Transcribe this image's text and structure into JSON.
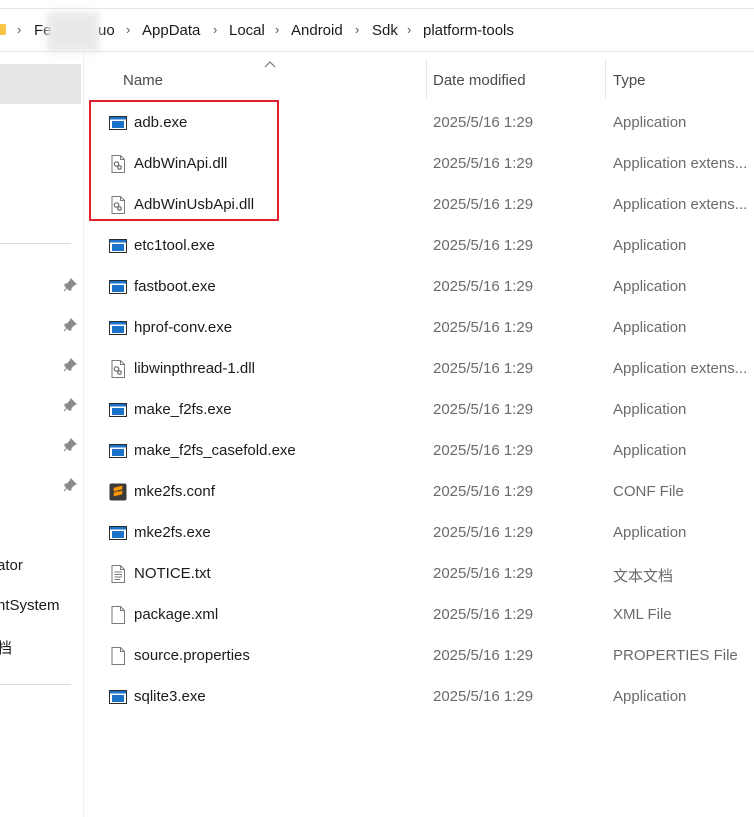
{
  "breadcrumb": {
    "items": [
      "Fe",
      "uo",
      "AppData",
      "Local",
      "Android",
      "Sdk",
      "platform-tools"
    ]
  },
  "sidebar": {
    "labels": [
      "ator",
      "ntSystem",
      "档"
    ]
  },
  "columns": {
    "name": "Name",
    "date": "Date modified",
    "type": "Type"
  },
  "files": [
    {
      "name": "adb.exe",
      "date": "2025/5/16 1:29",
      "type": "Application",
      "icon": "exe-icon"
    },
    {
      "name": "AdbWinApi.dll",
      "date": "2025/5/16 1:29",
      "type": "Application extens...",
      "icon": "dll-icon"
    },
    {
      "name": "AdbWinUsbApi.dll",
      "date": "2025/5/16 1:29",
      "type": "Application extens...",
      "icon": "dll-icon"
    },
    {
      "name": "etc1tool.exe",
      "date": "2025/5/16 1:29",
      "type": "Application",
      "icon": "exe-icon"
    },
    {
      "name": "fastboot.exe",
      "date": "2025/5/16 1:29",
      "type": "Application",
      "icon": "exe-icon"
    },
    {
      "name": "hprof-conv.exe",
      "date": "2025/5/16 1:29",
      "type": "Application",
      "icon": "exe-icon"
    },
    {
      "name": "libwinpthread-1.dll",
      "date": "2025/5/16 1:29",
      "type": "Application extens...",
      "icon": "dll-icon"
    },
    {
      "name": "make_f2fs.exe",
      "date": "2025/5/16 1:29",
      "type": "Application",
      "icon": "exe-icon"
    },
    {
      "name": "make_f2fs_casefold.exe",
      "date": "2025/5/16 1:29",
      "type": "Application",
      "icon": "exe-icon"
    },
    {
      "name": "mke2fs.conf",
      "date": "2025/5/16 1:29",
      "type": "CONF File",
      "icon": "sublime-icon"
    },
    {
      "name": "mke2fs.exe",
      "date": "2025/5/16 1:29",
      "type": "Application",
      "icon": "exe-icon"
    },
    {
      "name": "NOTICE.txt",
      "date": "2025/5/16 1:29",
      "type": "文本文档",
      "icon": "text-file-icon"
    },
    {
      "name": "package.xml",
      "date": "2025/5/16 1:29",
      "type": "XML File",
      "icon": "blank-file-icon"
    },
    {
      "name": "source.properties",
      "date": "2025/5/16 1:29",
      "type": "PROPERTIES File",
      "icon": "blank-file-icon"
    },
    {
      "name": "sqlite3.exe",
      "date": "2025/5/16 1:29",
      "type": "Application",
      "icon": "exe-icon"
    }
  ],
  "colors": {
    "highlight": "#e0202a",
    "exe_accent": "#1a73c8",
    "sublime_accent": "#ff9800"
  }
}
